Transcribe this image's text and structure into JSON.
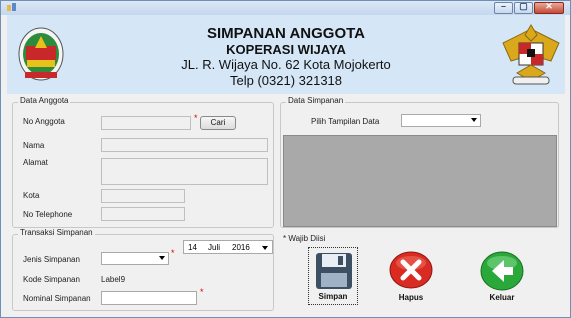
{
  "window": {
    "controls": {
      "minimize": "–",
      "maximize": "▢",
      "close": "✕"
    }
  },
  "header": {
    "title": "SIMPANAN ANGGOTA",
    "subtitle": "KOPERASI WIJAYA",
    "address": "JL. R. Wijaya No. 62 Kota Mojokerto",
    "phone": "Telp (0321) 321318"
  },
  "data_anggota": {
    "legend": "Data Anggota",
    "no_anggota_label": "No Anggota",
    "cari_button": "Cari",
    "nama_label": "Nama",
    "alamat_label": "Alamat",
    "kota_label": "Kota",
    "no_telephone_label": "No Telephone",
    "required_mark": "*"
  },
  "transaksi_simpanan": {
    "legend": "Transaksi Simpanan",
    "date": {
      "day": "14",
      "month": "Juli",
      "year": "2016"
    },
    "jenis_label": "Jenis Simpanan",
    "kode_label": "Kode Simpanan",
    "kode_value": "Label9",
    "nominal_label": "Nominal Simpanan",
    "required_mark": "*"
  },
  "data_simpanan": {
    "legend": "Data Simpanan",
    "pilih_label": "Pilih Tampilan Data"
  },
  "actions": {
    "wajib_diisi": "* Wajib Diisi",
    "simpan": "Simpan",
    "hapus": "Hapus",
    "keluar": "Keluar"
  },
  "colors": {
    "header_bg": "#d5e7f7",
    "grid_bg": "#a9a9a9",
    "required": "#dd0000"
  }
}
